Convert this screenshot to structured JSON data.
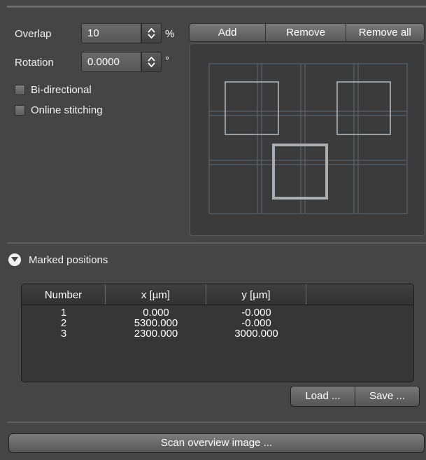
{
  "overlap": {
    "label": "Overlap",
    "value": "10",
    "unit": "%"
  },
  "rotation": {
    "label": "Rotation",
    "value": "0.0000",
    "unit": "°"
  },
  "options": [
    {
      "label": "Bi-directional",
      "checked": false
    },
    {
      "label": "Online stitching",
      "checked": false
    }
  ],
  "position_buttons": {
    "add": "Add",
    "remove": "Remove",
    "remove_all": "Remove all"
  },
  "marked_positions": {
    "title": "Marked positions",
    "columns": [
      "Number",
      "x [µm]",
      "y [µm]",
      ""
    ],
    "rows": [
      [
        "1",
        "0.000",
        "-0.000"
      ],
      [
        "2",
        "5300.000",
        "-0.000"
      ],
      [
        "3",
        "2300.000",
        "3000.000"
      ]
    ],
    "load_label": "Load ...",
    "save_label": "Save ..."
  },
  "scan_overview_label": "Scan overview image ...",
  "icons": {
    "spinner": "updown-arrows-icon",
    "section_toggle": "chevron-down-icon"
  }
}
